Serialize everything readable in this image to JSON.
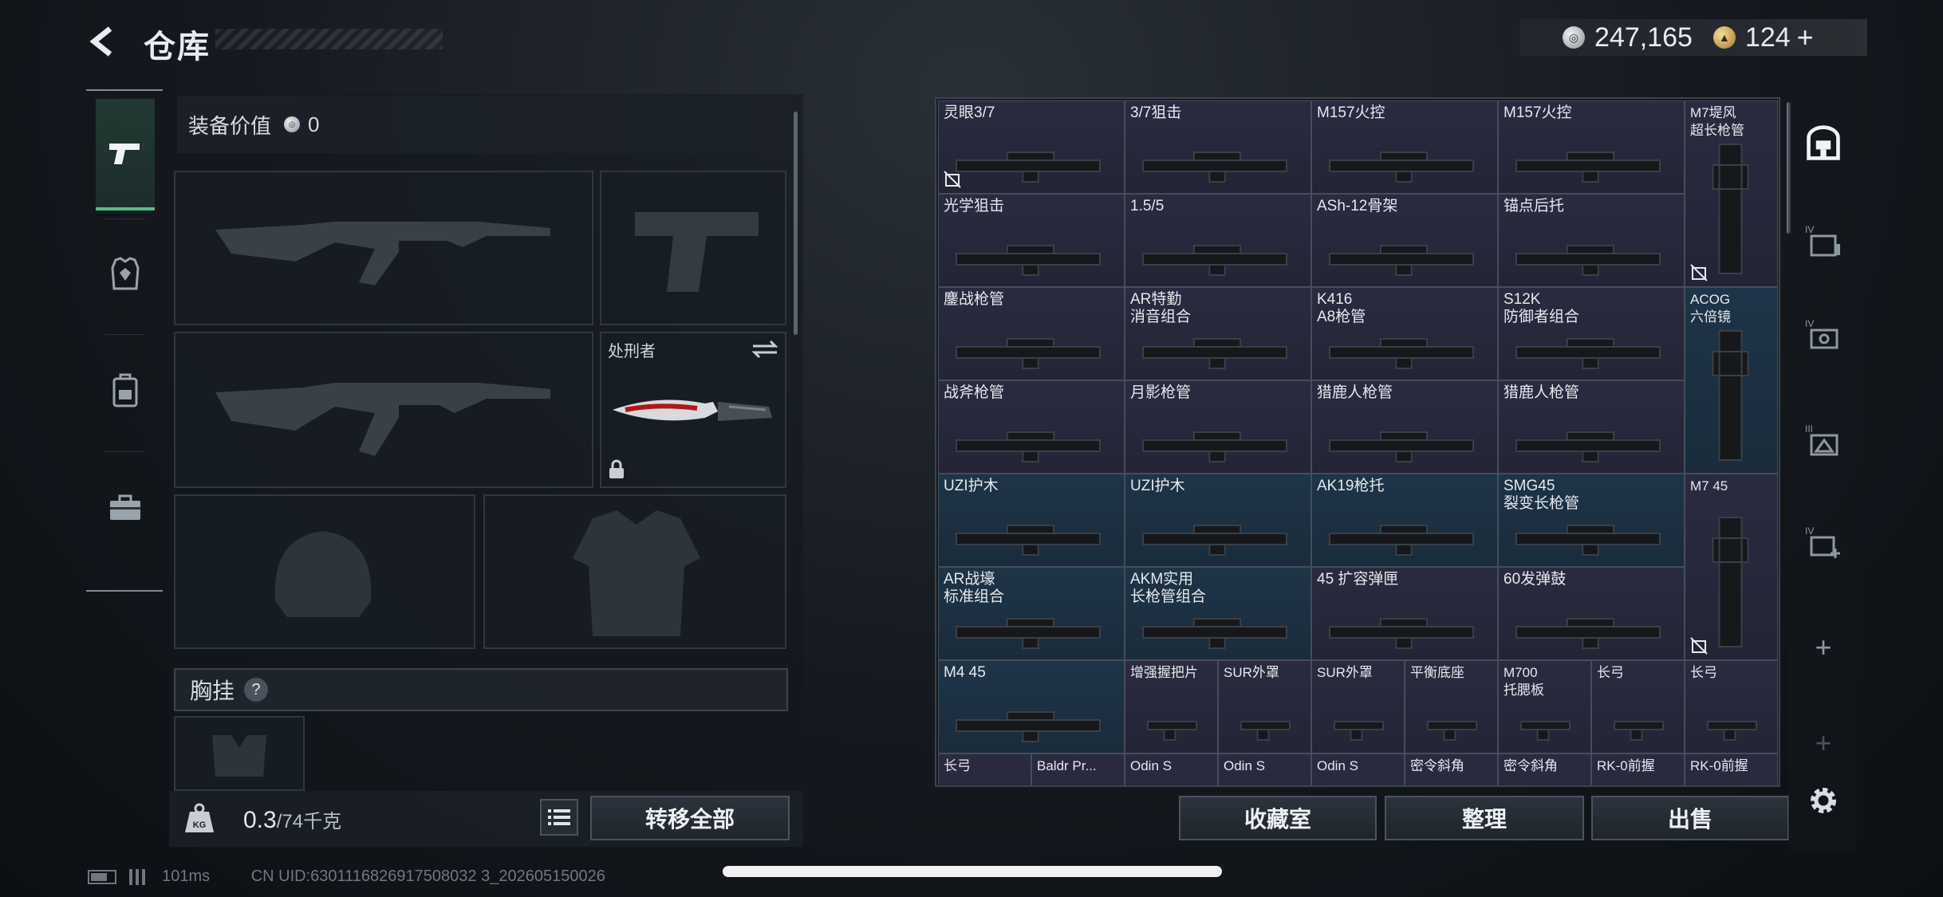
{
  "header": {
    "title": "仓库"
  },
  "currency": [
    {
      "icon": "silver-coin-icon",
      "value": "247,165"
    },
    {
      "icon": "gold-coin-icon",
      "value": "124"
    }
  ],
  "categories": [
    "pistol-icon",
    "armor-icon",
    "backpack-icon",
    "toolbox-icon"
  ],
  "equipment": {
    "value_label": "装备价值",
    "value": "0",
    "melee_label": "处刑者",
    "chest_rig_label": "胸挂",
    "help": "?"
  },
  "weight": {
    "current": "0.3",
    "max": "/74千克"
  },
  "buttons": {
    "transfer_all": "转移全部",
    "collection": "收藏室",
    "sort": "整理",
    "sell": "出售"
  },
  "grid": [
    {
      "name": "灵眼3/7",
      "unlockable": true
    },
    {
      "name": "3/7狙击"
    },
    {
      "name": "M157火控"
    },
    {
      "name": "M157火控"
    },
    {
      "name": "M7堤风\n超长枪管",
      "unlockable": true
    },
    {
      "name": "光学狙击"
    },
    {
      "name": "1.5/5"
    },
    {
      "name": "ASh-12骨架"
    },
    {
      "name": "锚点后托"
    },
    {
      "name": "鏖战枪管"
    },
    {
      "name": "AR特勤\n消音组合"
    },
    {
      "name": "K416\nA8枪管"
    },
    {
      "name": "S12K\n防御者组合"
    },
    {
      "name": "ACOG\n六倍镜"
    },
    {
      "name": "战斧枪管"
    },
    {
      "name": "月影枪管"
    },
    {
      "name": "猎鹿人枪管"
    },
    {
      "name": "猎鹿人枪管"
    },
    {
      "name": "UZI护木"
    },
    {
      "name": "UZI护木"
    },
    {
      "name": "AK19枪托"
    },
    {
      "name": "SMG45\n裂变长枪管"
    },
    {
      "name": "M7 45",
      "unlockable": true
    },
    {
      "name": "AR战壕\n标准组合"
    },
    {
      "name": "AKM实用\n长枪管组合"
    },
    {
      "name": "45 扩容弹匣"
    },
    {
      "name": "60发弹鼓"
    },
    {
      "name": "M4 45"
    },
    {
      "name": "增强握把片"
    },
    {
      "name": "SUR外罩"
    },
    {
      "name": "SUR外罩"
    },
    {
      "name": "平衡底座"
    },
    {
      "name": "M700\n托腮板"
    },
    {
      "name": "长弓"
    },
    {
      "name": "长弓"
    },
    {
      "name": "长弓"
    },
    {
      "name": "Baldr Pr..."
    },
    {
      "name": "Odin S"
    },
    {
      "name": "Odin S"
    },
    {
      "name": "Odin S"
    },
    {
      "name": "密令斜角"
    },
    {
      "name": "密令斜角"
    },
    {
      "name": "RK-0前握"
    },
    {
      "name": "RK-0前握"
    }
  ],
  "side_filters": [
    "vault-icon",
    "IV",
    "IV",
    "III",
    "IV",
    "+",
    "+",
    "gear-icon"
  ],
  "status": {
    "ping": "101ms",
    "uid": "CN UID:6301116826917508032 3_202605150026"
  }
}
